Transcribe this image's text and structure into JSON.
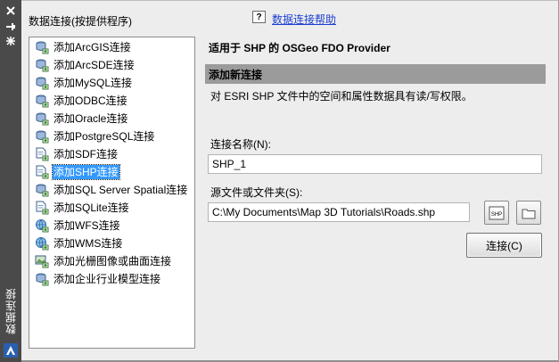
{
  "sidebar_strip": {
    "title": "数据连接",
    "icons": [
      "close-icon",
      "pin-icon",
      "settings-icon"
    ]
  },
  "list": {
    "title": "数据连接(按提供程序)",
    "selected_index": 7,
    "items": [
      {
        "label": "添加ArcGIS连接",
        "icon": "database-connect-icon"
      },
      {
        "label": "添加ArcSDE连接",
        "icon": "database-connect-icon"
      },
      {
        "label": "添加MySQL连接",
        "icon": "database-connect-icon"
      },
      {
        "label": "添加ODBC连接",
        "icon": "database-connect-icon"
      },
      {
        "label": "添加Oracle连接",
        "icon": "database-connect-icon"
      },
      {
        "label": "添加PostgreSQL连接",
        "icon": "database-connect-icon"
      },
      {
        "label": "添加SDF连接",
        "icon": "file-connect-icon"
      },
      {
        "label": "添加SHP连接",
        "icon": "file-connect-icon"
      },
      {
        "label": "添加SQL Server Spatial连接",
        "icon": "database-connect-icon"
      },
      {
        "label": "添加SQLite连接",
        "icon": "file-connect-icon"
      },
      {
        "label": "添加WFS连接",
        "icon": "globe-connect-icon"
      },
      {
        "label": "添加WMS连接",
        "icon": "globe-connect-icon"
      },
      {
        "label": "添加光栅图像或曲面连接",
        "icon": "raster-connect-icon"
      },
      {
        "label": "添加企业行业模型连接",
        "icon": "database-connect-icon"
      }
    ]
  },
  "help": {
    "icon_text": "?",
    "link": "数据连接帮助"
  },
  "detail": {
    "provider_title": "适用于 SHP 的 OSGeo FDO Provider",
    "section_header": "添加新连接",
    "description": "对 ESRI SHP 文件中的空间和属性数据具有读/写权限。",
    "connection_name_label": "连接名称(N):",
    "connection_name_value": "SHP_1",
    "source_label": "源文件或文件夹(S):",
    "source_value": "C:\\My Documents\\Map 3D Tutorials\\Roads.shp",
    "shp_button_text": "SHP",
    "connect_button": "连接(C)"
  },
  "colors": {
    "strip": "#4a4a4a",
    "selection": "#3399ff",
    "section_header": "#9b9b9b",
    "link": "#1d3fd0"
  }
}
